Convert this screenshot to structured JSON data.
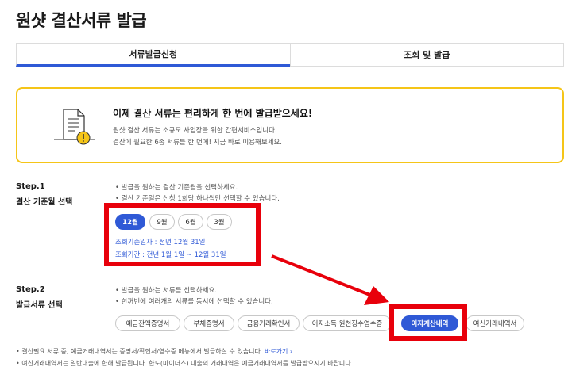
{
  "page": {
    "title": "원샷 결산서류 발급"
  },
  "tabs": [
    {
      "label": "서류발급신청",
      "active": true
    },
    {
      "label": "조회 및 발급",
      "active": false
    }
  ],
  "notice": {
    "icon": "document-warning-icon",
    "title": "이제 결산 서류는 편리하게 한 번에 발급받으세요!",
    "line1": "원샷 결산 서류는 소규모 사업장을 위한 간편서비스입니다.",
    "line2": "결산에 필요한 6종 서류를 한 번에! 지금 바로 이용해보세요."
  },
  "step1": {
    "label": "Step.1",
    "sub": "결산 기준월 선택",
    "bullets": [
      "• 발급을 원하는 결산 기준월을 선택하세요.",
      "• 결산 기준일은 신청 1회당 하나씩만 선택할 수 있습니다."
    ],
    "months": [
      "12월",
      "9월",
      "6월",
      "3월"
    ],
    "selected_month": "12월",
    "base_date": "조회기준일자 : 전년 12월 31일",
    "period": "조회기간 : 전년 1월 1일 ~ 12월 31일"
  },
  "step2": {
    "label": "Step.2",
    "sub": "발급서류 선택",
    "bullets": [
      "• 발급을 원하는 서류를 선택하세요.",
      "• 한꺼번에 여러개의 서류를 동시에 선택할 수 있습니다."
    ],
    "documents": [
      "예금잔액증명서",
      "부채증명서",
      "금융거래확인서",
      "이자소득 원천징수영수증",
      "이자계산내역",
      "여신거래내역서"
    ],
    "selected_document": "이자계산내역"
  },
  "footer": {
    "note1": "• 결산필요 서류 중, 예금거래내역서는 증명서/확인서/영수증 메뉴에서 발급하실 수 있습니다.",
    "link": "바로가기 ›",
    "note2": "• 여신거래내역서는 일반대출에 한해 발급됩니다. 한도(마이너스) 대출의 거래내역은 예금거래내역서를 발급받으시기 바랍니다."
  },
  "colors": {
    "accent": "#2f59d6",
    "highlight": "#e8000b",
    "notice_border": "#f5c518"
  }
}
